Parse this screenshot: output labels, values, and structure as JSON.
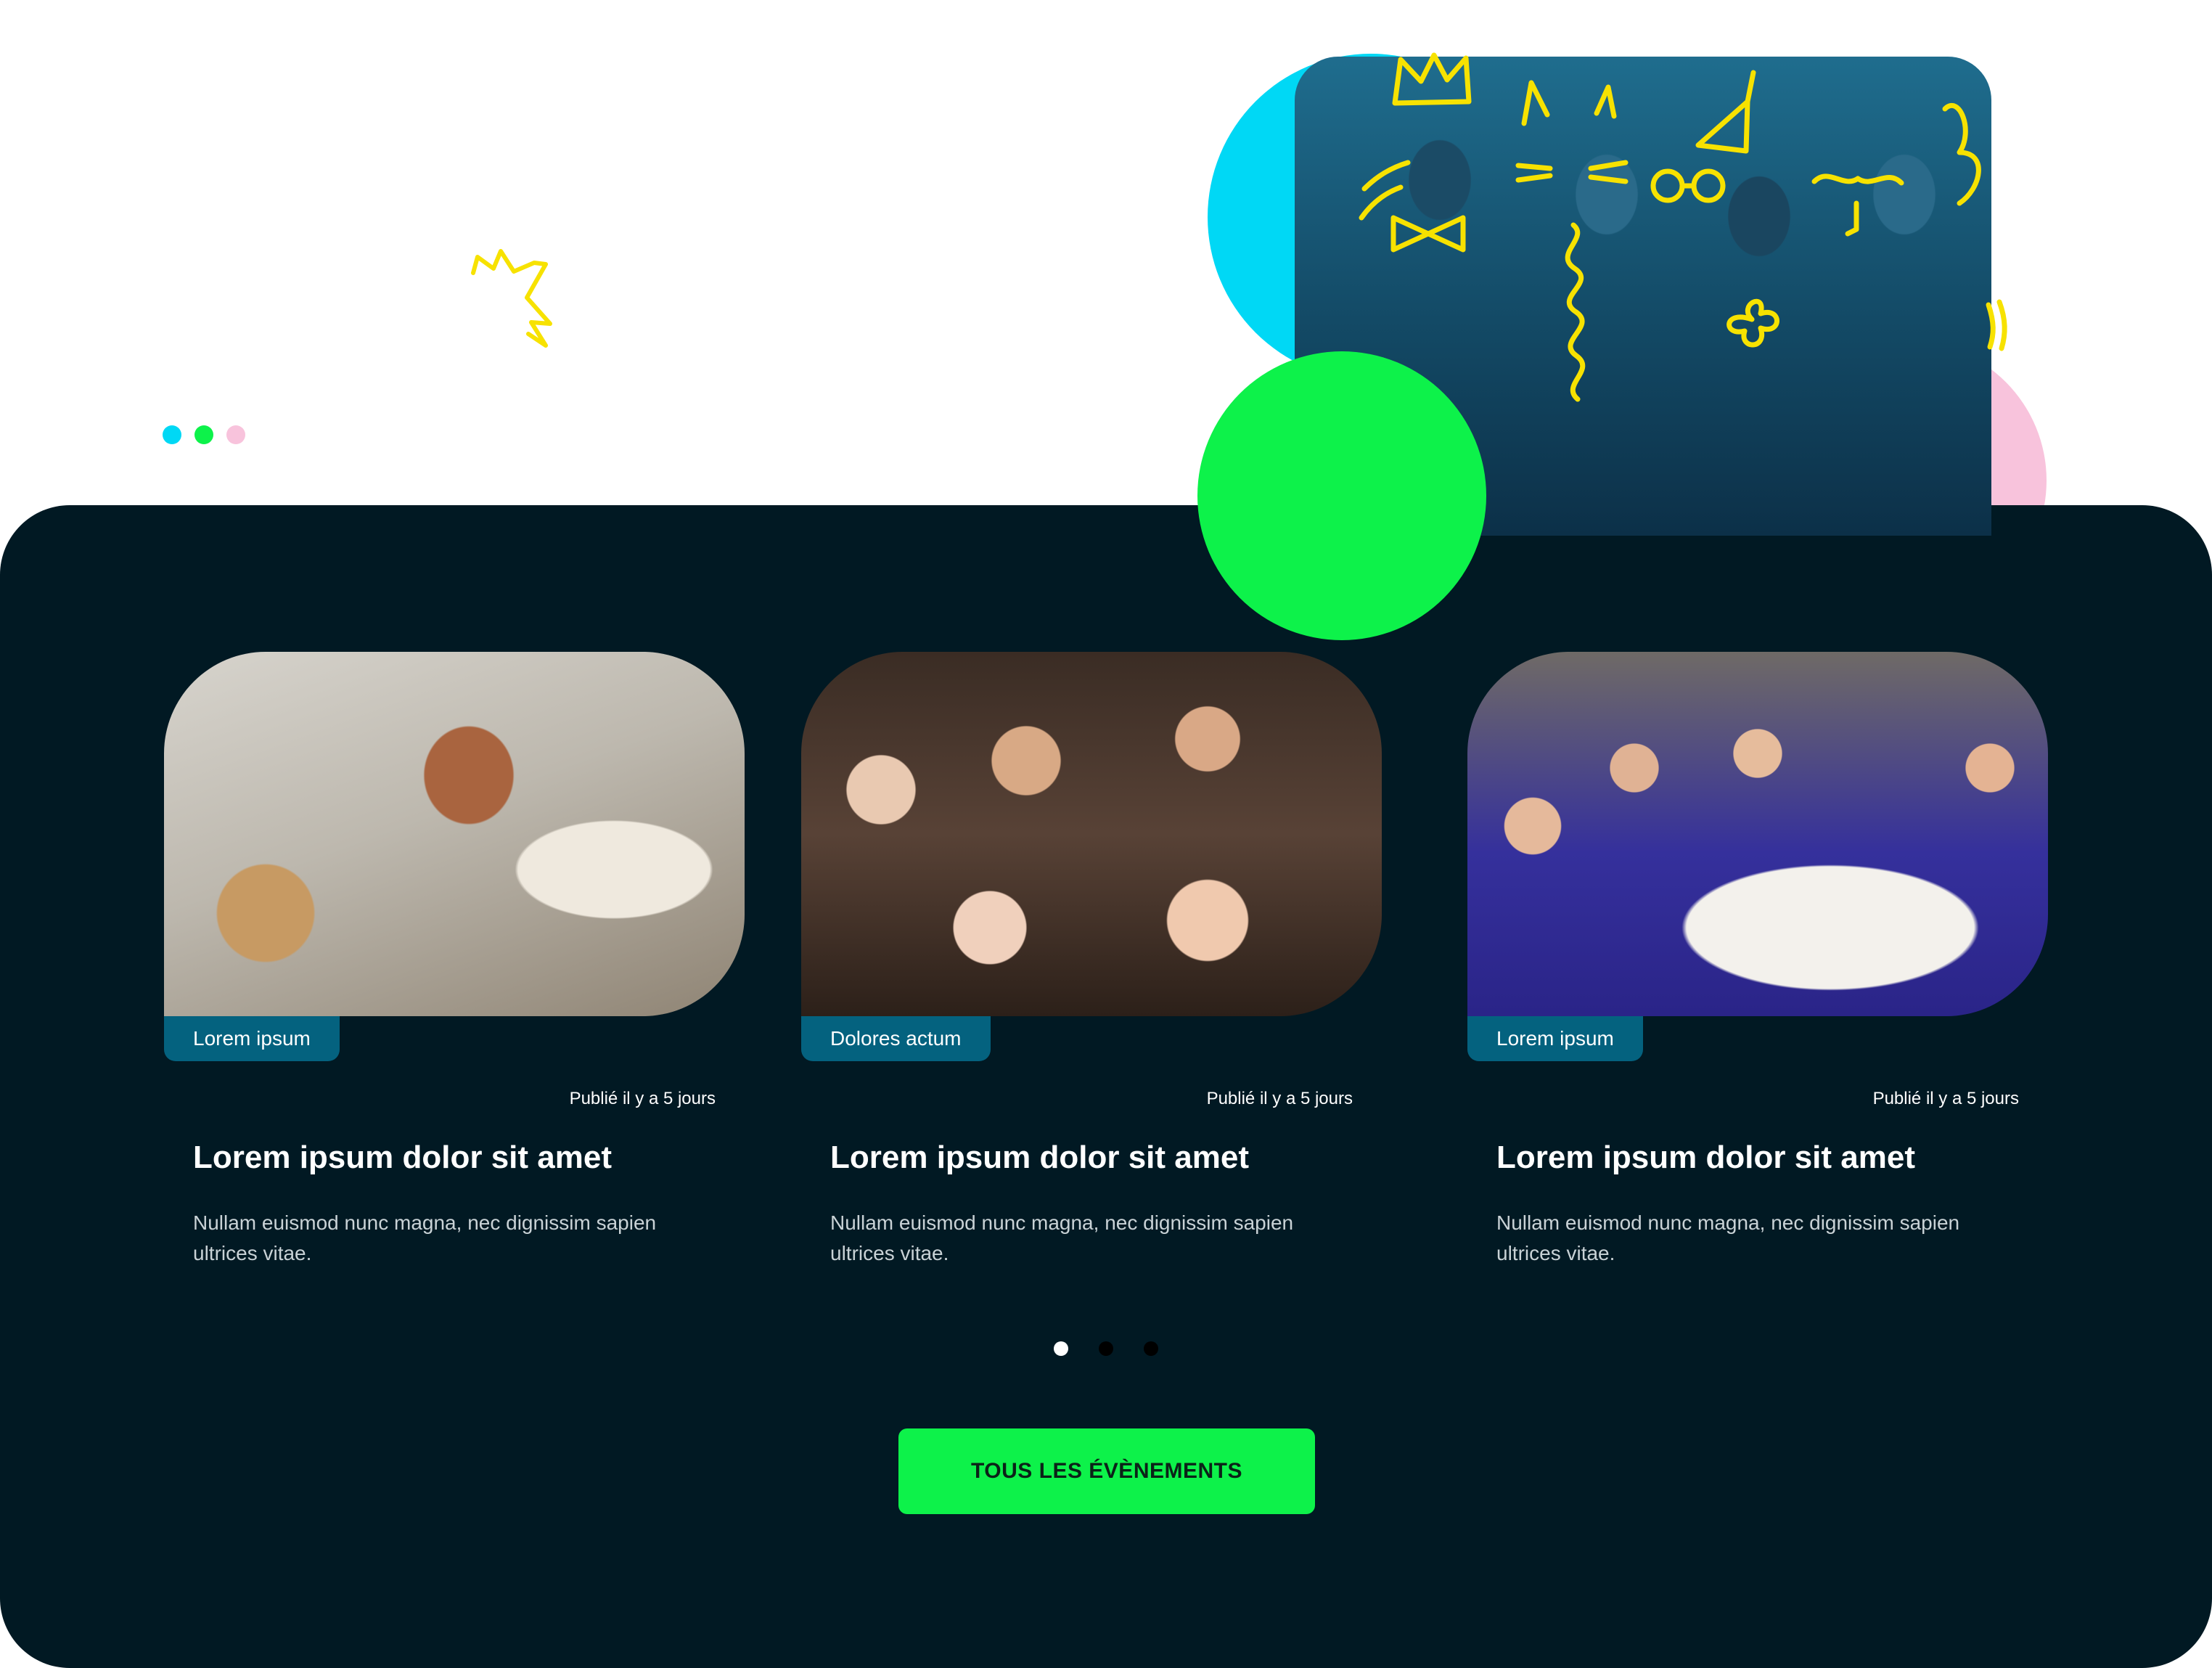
{
  "colors": {
    "panel": "#011923",
    "accent_green": "#0df24a",
    "accent_cyan": "#00d8f5",
    "accent_pink": "#f8c3dc",
    "doodle_yellow": "#f7e200",
    "tag_bg": "#04627f"
  },
  "decor": {
    "dots": [
      "cyan",
      "green",
      "pink"
    ],
    "hero_image": "kids-group-photo",
    "squiggle": "yellow-zigzag-doodle"
  },
  "cards": [
    {
      "image": "kids-pottery-photo",
      "tag": "Lorem ipsum",
      "published": "Publié il y a 5 jours",
      "title": "Lorem ipsum dolor sit amet",
      "description": "Nullam euismod nunc magna, nec dignissim sapien ultrices vitae."
    },
    {
      "image": "kids-headphones-photo",
      "tag": "Dolores actum",
      "published": "Publié il y a 5 jours",
      "title": "Lorem ipsum dolor sit amet",
      "description": "Nullam euismod nunc magna, nec dignissim sapien ultrices vitae."
    },
    {
      "image": "kids-painting-photo",
      "tag": "Lorem ipsum",
      "published": "Publié il y a 5 jours",
      "title": "Lorem ipsum dolor sit amet",
      "description": "Nullam euismod nunc magna, nec dignissim sapien ultrices vitae."
    }
  ],
  "pager": {
    "count": 3,
    "active": 0
  },
  "cta": {
    "label": "TOUS LES ÉVÈNEMENTS"
  }
}
